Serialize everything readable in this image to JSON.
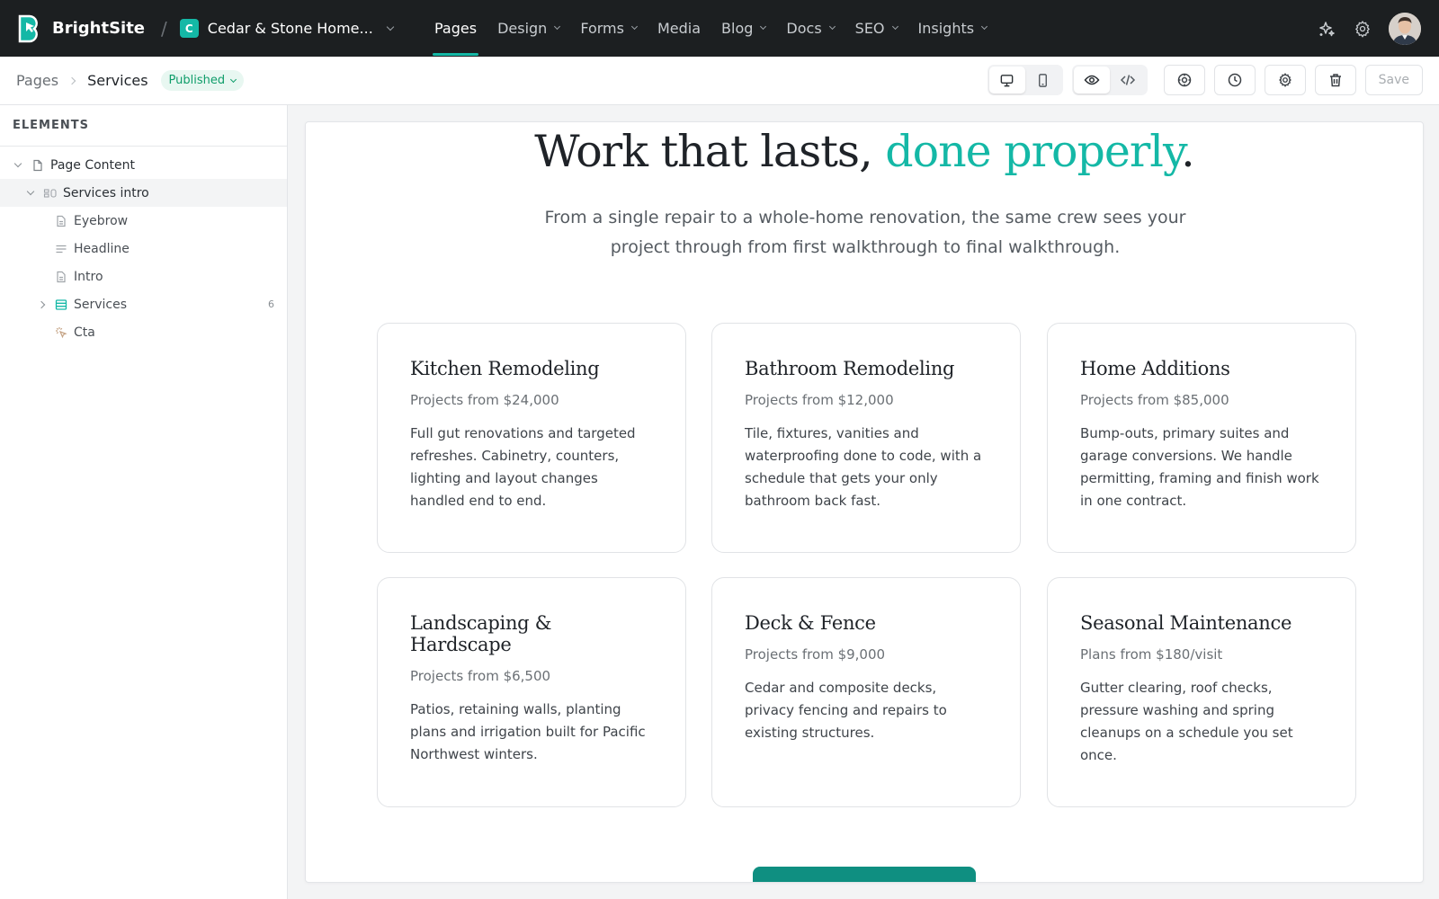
{
  "topbar": {
    "brand": "BrightSite",
    "separator": "/",
    "site_badge": "C",
    "site_name": "Cedar & Stone Home...",
    "nav": [
      {
        "label": "Pages",
        "active": true,
        "has_menu": false
      },
      {
        "label": "Design",
        "active": false,
        "has_menu": true
      },
      {
        "label": "Forms",
        "active": false,
        "has_menu": true
      },
      {
        "label": "Media",
        "active": false,
        "has_menu": false
      },
      {
        "label": "Blog",
        "active": false,
        "has_menu": true
      },
      {
        "label": "Docs",
        "active": false,
        "has_menu": true
      },
      {
        "label": "SEO",
        "active": false,
        "has_menu": true
      },
      {
        "label": "Insights",
        "active": false,
        "has_menu": true
      }
    ],
    "icons": [
      "sparkle-icon",
      "gear-icon",
      "avatar"
    ]
  },
  "subbar": {
    "breadcrumb_root": "Pages",
    "breadcrumb_current": "Services",
    "status": "Published",
    "save_label": "Save",
    "device_mode": "desktop",
    "view_mode": "preview"
  },
  "sidebar": {
    "title": "ELEMENTS",
    "tree": [
      {
        "label": "Page Content",
        "level": 0,
        "expanded": true,
        "icon": "page-icon"
      },
      {
        "label": "Services intro",
        "level": 1,
        "expanded": true,
        "icon": "section-icon",
        "selected": true
      },
      {
        "label": "Eyebrow",
        "level": 2,
        "icon": "doc-icon"
      },
      {
        "label": "Headline",
        "level": 2,
        "icon": "text-lines-icon"
      },
      {
        "label": "Intro",
        "level": 2,
        "icon": "doc-icon"
      },
      {
        "label": "Services",
        "level": 2,
        "expanded": false,
        "icon": "list-icon",
        "count": "6"
      },
      {
        "label": "Cta",
        "level": 2,
        "icon": "cta-icon"
      }
    ]
  },
  "content": {
    "headline_main": "Work that lasts, ",
    "headline_accent": "done properly",
    "headline_end": ".",
    "intro": "From a single repair to a whole-home renovation, the same crew sees your project through from first walkthrough to final walkthrough.",
    "services": [
      {
        "title": "Kitchen Remodeling",
        "price": "Projects from $24,000",
        "desc": "Full gut renovations and targeted refreshes. Cabinetry, counters, lighting and layout changes handled end to end."
      },
      {
        "title": "Bathroom Remodeling",
        "price": "Projects from $12,000",
        "desc": "Tile, fixtures, vanities and waterproofing done to code, with a schedule that gets your only bathroom back fast."
      },
      {
        "title": "Home Additions",
        "price": "Projects from $85,000",
        "desc": "Bump-outs, primary suites and garage conversions. We handle permitting, framing and finish work in one contract."
      },
      {
        "title": "Landscaping & Hardscape",
        "price": "Projects from $6,500",
        "desc": "Patios, retaining walls, planting plans and irrigation built for Pacific Northwest winters."
      },
      {
        "title": "Deck & Fence",
        "price": "Projects from $9,000",
        "desc": "Cedar and composite decks, privacy fencing and repairs to existing structures."
      },
      {
        "title": "Seasonal Maintenance",
        "price": "Plans from $180/visit",
        "desc": "Gutter clearing, roof checks, pressure washing and spring cleanups on a schedule you set once."
      }
    ]
  },
  "colors": {
    "accent": "#14b8a6",
    "topbar_bg": "#1c1f21",
    "cta": "#0f8f81",
    "status_green": "#0f9d6a"
  }
}
